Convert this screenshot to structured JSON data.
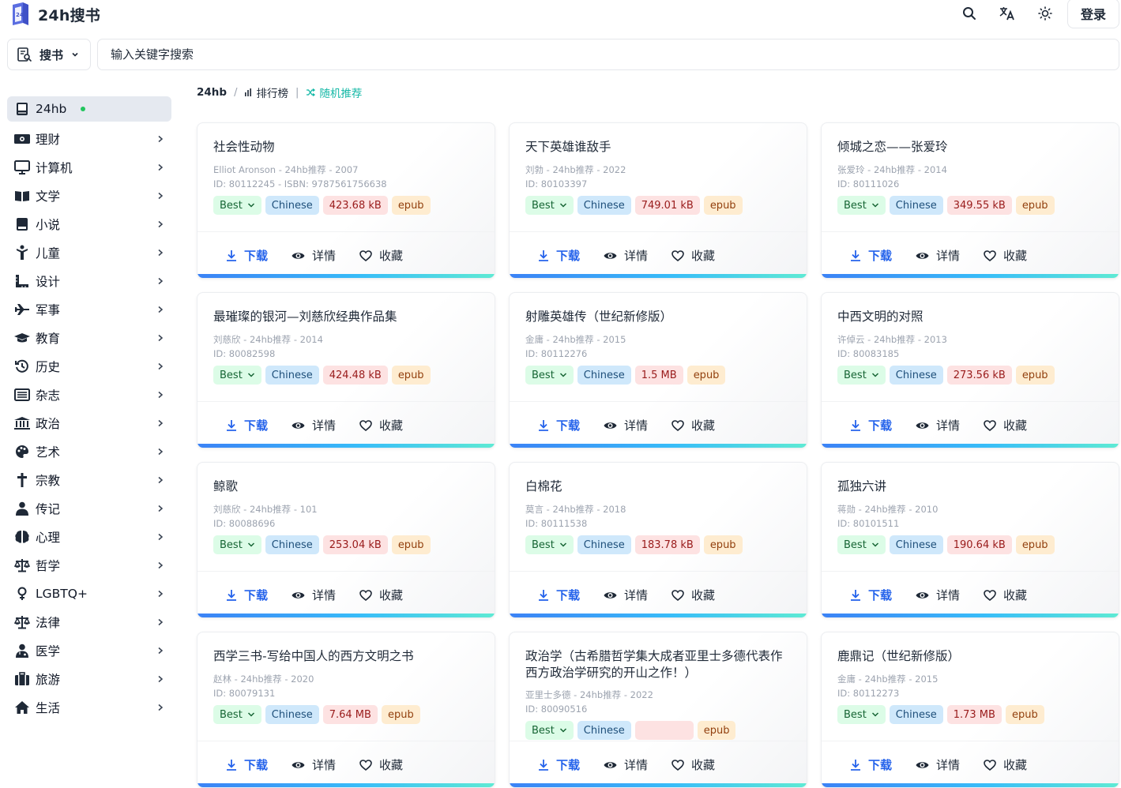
{
  "header": {
    "logo_text": "24h搜书",
    "login_label": "登录",
    "icons": [
      "search-icon",
      "translate-icon",
      "theme-sun-icon"
    ]
  },
  "search": {
    "scope_label": "搜书",
    "placeholder": "输入关键字搜索"
  },
  "sidebar": {
    "items": [
      {
        "label": "24hb",
        "icon": "book-icon",
        "active": true
      },
      {
        "label": "理财",
        "icon": "money-icon"
      },
      {
        "label": "计算机",
        "icon": "monitor-icon"
      },
      {
        "label": "文学",
        "icon": "open-book-icon"
      },
      {
        "label": "小说",
        "icon": "book-closed-icon"
      },
      {
        "label": "儿童",
        "icon": "child-icon"
      },
      {
        "label": "设计",
        "icon": "ruler-icon"
      },
      {
        "label": "军事",
        "icon": "plane-icon"
      },
      {
        "label": "教育",
        "icon": "graduation-cap-icon"
      },
      {
        "label": "历史",
        "icon": "history-icon"
      },
      {
        "label": "杂志",
        "icon": "newspaper-icon"
      },
      {
        "label": "政治",
        "icon": "landmark-icon"
      },
      {
        "label": "艺术",
        "icon": "palette-icon"
      },
      {
        "label": "宗教",
        "icon": "cross-icon"
      },
      {
        "label": "传记",
        "icon": "person-icon"
      },
      {
        "label": "心理",
        "icon": "brain-icon"
      },
      {
        "label": "哲学",
        "icon": "scale-icon"
      },
      {
        "label": "LGBTQ+",
        "icon": "venus-icon"
      },
      {
        "label": "法律",
        "icon": "scale-icon"
      },
      {
        "label": "医学",
        "icon": "doctor-icon"
      },
      {
        "label": "旅游",
        "icon": "suitcase-icon"
      },
      {
        "label": "生活",
        "icon": "home-icon"
      }
    ]
  },
  "breadcrumb": {
    "root": "24hb",
    "ranking": "排行榜",
    "random": "随机推荐"
  },
  "actions": {
    "download": "下载",
    "details": "详情",
    "favorite": "收藏"
  },
  "books": [
    {
      "title": "社会性动物",
      "meta": "Elliot Aronson - 24hb推荐 - 2007",
      "ids": "ID: 80112245 - ISBN: 9787561756638",
      "best": "Best",
      "lang": "Chinese",
      "size": "423.68 kB",
      "format": "epub"
    },
    {
      "title": "天下英雄谁敌手",
      "meta": "刘勃 - 24hb推荐 - 2022",
      "ids": "ID: 80103397",
      "best": "Best",
      "lang": "Chinese",
      "size": "749.01 kB",
      "format": "epub"
    },
    {
      "title": "倾城之恋——张爱玲",
      "meta": "张爱玲 - 24hb推荐 - 2014",
      "ids": "ID: 80111026",
      "best": "Best",
      "lang": "Chinese",
      "size": "349.55 kB",
      "format": "epub"
    },
    {
      "title": "最璀璨的银河—刘慈欣经典作品集",
      "meta": "刘慈欣 - 24hb推荐 - 2014",
      "ids": "ID: 80082598",
      "best": "Best",
      "lang": "Chinese",
      "size": "424.48 kB",
      "format": "epub"
    },
    {
      "title": "射雕英雄传（世纪新修版）",
      "meta": "金庸 - 24hb推荐 - 2015",
      "ids": "ID: 80112276",
      "best": "Best",
      "lang": "Chinese",
      "size": "1.5 MB",
      "format": "epub"
    },
    {
      "title": "中西文明的对照",
      "meta": "许倬云 - 24hb推荐 - 2013",
      "ids": "ID: 80083185",
      "best": "Best",
      "lang": "Chinese",
      "size": "273.56 kB",
      "format": "epub"
    },
    {
      "title": "鲸歌",
      "meta": "刘慈欣 - 24hb推荐 - 101",
      "ids": "ID: 80088696",
      "best": "Best",
      "lang": "Chinese",
      "size": "253.04 kB",
      "format": "epub"
    },
    {
      "title": "白棉花",
      "meta": "莫言 - 24hb推荐 - 2018",
      "ids": "ID: 80111538",
      "best": "Best",
      "lang": "Chinese",
      "size": "183.78 kB",
      "format": "epub"
    },
    {
      "title": "孤独六讲",
      "meta": "蒋勋 - 24hb推荐 - 2010",
      "ids": "ID: 80101511",
      "best": "Best",
      "lang": "Chinese",
      "size": "190.64 kB",
      "format": "epub"
    },
    {
      "title": "西学三书-写给中国人的西方文明之书",
      "meta": "赵林 - 24hb推荐 - 2020",
      "ids": "ID: 80079131",
      "best": "Best",
      "lang": "Chinese",
      "size": "7.64 MB",
      "format": "epub"
    },
    {
      "title": "政治学（古希腊哲学集大成者亚里士多德代表作 西方政治学研究的开山之作！）",
      "meta": "亚里士多德 - 24hb推荐 - 2022",
      "ids": "ID: 80090516",
      "best": "Best",
      "lang": "Chinese",
      "size": "",
      "format": "epub"
    },
    {
      "title": "鹿鼎记（世纪新修版）",
      "meta": "金庸 - 24hb推荐 - 2015",
      "ids": "ID: 80112273",
      "best": "Best",
      "lang": "Chinese",
      "size": "1.73 MB",
      "format": "epub"
    }
  ],
  "colors": {
    "accent_blue": "#2563eb",
    "teal": "#14b8a6",
    "status_green": "#22c55e"
  }
}
